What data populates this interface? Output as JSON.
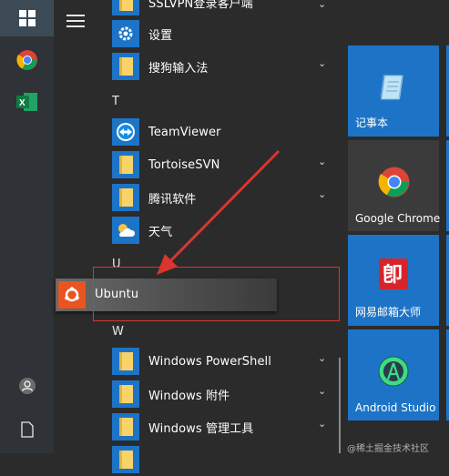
{
  "app_list": {
    "items": [
      {
        "key": "sslvpn",
        "label": "SSLVPN登录客户端",
        "type": "folder",
        "expandable": true
      },
      {
        "key": "settings",
        "label": "设置",
        "type": "settings",
        "expandable": false
      },
      {
        "key": "sogou",
        "label": "搜狗输入法",
        "type": "folder",
        "expandable": true
      },
      {
        "key": "teamviewer",
        "label": "TeamViewer",
        "type": "teamviewer",
        "expandable": false
      },
      {
        "key": "tortoisesvn",
        "label": "TortoiseSVN",
        "type": "folder",
        "expandable": true
      },
      {
        "key": "tencent",
        "label": "腾讯软件",
        "type": "folder",
        "expandable": true
      },
      {
        "key": "weather",
        "label": "天气",
        "type": "weather",
        "expandable": false
      },
      {
        "key": "ubuntu",
        "label": "Ubuntu",
        "type": "ubuntu",
        "expandable": false
      },
      {
        "key": "powershell",
        "label": "Windows PowerShell",
        "type": "folder",
        "expandable": true
      },
      {
        "key": "accessories",
        "label": "Windows 附件",
        "type": "folder",
        "expandable": true
      },
      {
        "key": "admintools",
        "label": "Windows 管理工具",
        "type": "folder",
        "expandable": true
      }
    ],
    "headers": {
      "t": "T",
      "u": "U",
      "w": "W"
    }
  },
  "tiles": {
    "notepad": "记事本",
    "chrome": "Google Chrome",
    "mail": "网易邮箱大师",
    "android_studio": "Android Studio"
  },
  "watermark": "@稀土掘金技术社区",
  "colors": {
    "accent_tile": "#1d74c7",
    "chrome_tile": "#3b3b3b",
    "mail_red": "#d7242b",
    "ubuntu_orange": "#e95420",
    "annotation_red": "#d9362f"
  }
}
